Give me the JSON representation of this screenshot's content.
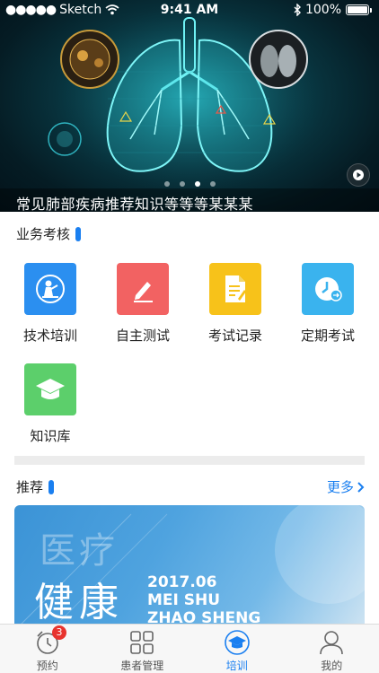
{
  "status_bar": {
    "carrier": "Sketch",
    "time": "9:41 AM",
    "battery": "100%"
  },
  "banner": {
    "caption": "常见肺部疾病推荐知识等等等某某某",
    "slide_count": 4,
    "active_slide": 2
  },
  "business": {
    "title": "业务考核",
    "items": [
      {
        "label": "技术培训",
        "color": "#2b8ff0",
        "icon": "trainer-icon"
      },
      {
        "label": "自主测试",
        "color": "#f26262",
        "icon": "pen-icon"
      },
      {
        "label": "考试记录",
        "color": "#f7c21a",
        "icon": "document-icon"
      },
      {
        "label": "定期考试",
        "color": "#3ab3ee",
        "icon": "clock-icon"
      },
      {
        "label": "知识库",
        "color": "#5ccf6b",
        "icon": "graduation-cap-icon"
      }
    ]
  },
  "recommend": {
    "title": "推荐",
    "more_label": "更多",
    "card": {
      "headline_top": "医疗",
      "headline_bottom": "健康",
      "date": "2017.06",
      "line1": "MEI SHU",
      "line2": "ZHAO SHENG"
    }
  },
  "tabbar": {
    "tabs": [
      {
        "label": "预约",
        "icon": "alarm-clock-icon",
        "badge": "3"
      },
      {
        "label": "患者管理",
        "icon": "grid-icon"
      },
      {
        "label": "培训",
        "icon": "graduation-cap-icon",
        "active": true
      },
      {
        "label": "我的",
        "icon": "user-icon"
      }
    ]
  },
  "colors": {
    "accent": "#1a7ff0",
    "badge": "#e8332e"
  }
}
